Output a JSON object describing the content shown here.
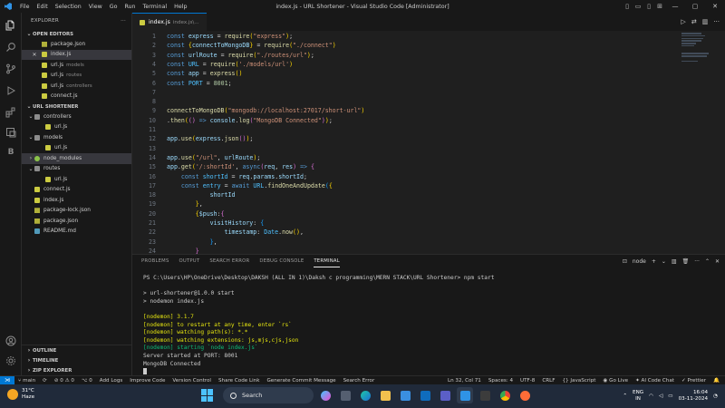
{
  "window": {
    "title": "index.js - URL Shortener - Visual Studio Code [Administrator]",
    "menu": [
      "File",
      "Edit",
      "Selection",
      "View",
      "Go",
      "Run",
      "Terminal",
      "Help"
    ]
  },
  "sidebar": {
    "header": "EXPLORER",
    "open_editors_label": "OPEN EDITORS",
    "open_editors": [
      {
        "name": "package.json",
        "desc": "",
        "icon": "json"
      },
      {
        "name": "index.js",
        "desc": "",
        "icon": "js",
        "active": true
      },
      {
        "name": "url.js",
        "desc": "models",
        "icon": "js"
      },
      {
        "name": "url.js",
        "desc": "routes",
        "icon": "js"
      },
      {
        "name": "url.js",
        "desc": "controllers",
        "icon": "js"
      },
      {
        "name": "connect.js",
        "desc": "",
        "icon": "js"
      }
    ],
    "project_label": "URL SHORTENER",
    "tree": [
      {
        "name": "controllers",
        "type": "folder",
        "depth": 1
      },
      {
        "name": "url.js",
        "type": "js",
        "depth": 2
      },
      {
        "name": "models",
        "type": "folder",
        "depth": 1
      },
      {
        "name": "url.js",
        "type": "js",
        "depth": 2
      },
      {
        "name": "node_modules",
        "type": "nm",
        "depth": 1
      },
      {
        "name": "routes",
        "type": "folder",
        "depth": 1
      },
      {
        "name": "url.js",
        "type": "js",
        "depth": 2
      },
      {
        "name": "connect.js",
        "type": "js",
        "depth": 1
      },
      {
        "name": "index.js",
        "type": "js",
        "depth": 1
      },
      {
        "name": "package-lock.json",
        "type": "json",
        "depth": 1
      },
      {
        "name": "package.json",
        "type": "json",
        "depth": 1
      },
      {
        "name": "README.md",
        "type": "md",
        "depth": 1
      }
    ],
    "outline_label": "OUTLINE",
    "timeline_label": "TIMELINE",
    "zip_label": "ZIP EXPLORER"
  },
  "editor": {
    "tab_name": "index.js",
    "tab_path": "index.js\\...",
    "lines": [
      {
        "n": "1",
        "html": "<span class='k'>const</span> <span class='v'>express</span> <span class='p'>=</span> <span class='f'>require</span><span class='b1'>(</span><span class='s'>\"express\"</span><span class='b1'>)</span><span class='p'>;</span>"
      },
      {
        "n": "2",
        "html": "<span class='k'>const</span> <span class='b1'>{</span><span class='v'>connectToMongoDB</span><span class='b1'>}</span> <span class='p'>=</span> <span class='f'>require</span><span class='b1'>(</span><span class='s'>\"./connect\"</span><span class='b1'>)</span>"
      },
      {
        "n": "3",
        "html": "<span class='k'>const</span> <span class='v'>urlRoute</span> <span class='p'>=</span> <span class='f'>require</span><span class='b1'>(</span><span class='s'>\"./routes/url\"</span><span class='b1'>)</span><span class='p'>;</span>"
      },
      {
        "n": "4",
        "html": "<span class='k'>const</span> <span class='c2'>URL</span> <span class='p'>=</span> <span class='f'>require</span><span class='b1'>(</span><span class='s'>'./models/url'</span><span class='b1'>)</span>"
      },
      {
        "n": "5",
        "html": "<span class='k'>const</span> <span class='v'>app</span> <span class='p'>=</span> <span class='f'>express</span><span class='b1'>()</span>"
      },
      {
        "n": "6",
        "html": "<span class='k'>const</span> <span class='c2'>PORT</span> <span class='p'>=</span> <span class='n'>8001</span><span class='p'>;</span>"
      },
      {
        "n": "7",
        "html": ""
      },
      {
        "n": "8",
        "html": ""
      },
      {
        "n": "9",
        "html": "<span class='f'>connectToMongoDB</span><span class='b1'>(</span><span class='s'>\"mongodb://localhost:27017/short-url\"</span><span class='b1'>)</span>"
      },
      {
        "n": "10",
        "html": "<span class='p'>.</span><span class='f'>then</span><span class='b1'>(</span><span class='b2'>()</span> <span class='k'>=&gt;</span> <span class='v'>console</span><span class='p'>.</span><span class='f'>log</span><span class='b2'>(</span><span class='s'>\"MongoDB Connected\"</span><span class='b2'>)</span><span class='b1'>)</span><span class='p'>;</span>"
      },
      {
        "n": "11",
        "html": ""
      },
      {
        "n": "12",
        "html": "<span class='v'>app</span><span class='p'>.</span><span class='f'>use</span><span class='b1'>(</span><span class='v'>express</span><span class='p'>.</span><span class='f'>json</span><span class='b2'>()</span><span class='b1'>)</span><span class='p'>;</span>"
      },
      {
        "n": "13",
        "html": ""
      },
      {
        "n": "14",
        "html": "<span class='v'>app</span><span class='p'>.</span><span class='f'>use</span><span class='b1'>(</span><span class='s'>\"/url\"</span><span class='p'>,</span> <span class='v'>urlRoute</span><span class='b1'>)</span><span class='p'>;</span>"
      },
      {
        "n": "15",
        "html": "<span class='v'>app</span><span class='p'>.</span><span class='f'>get</span><span class='b1'>(</span><span class='s'>'/:shortId'</span><span class='p'>,</span> <span class='k'>async</span><span class='b2'>(</span><span class='v'>req</span><span class='p'>,</span> <span class='v'>res</span><span class='b2'>)</span> <span class='k'>=&gt;</span> <span class='b2'>{</span>"
      },
      {
        "n": "16",
        "html": "    <span class='k'>const</span> <span class='c2'>shortId</span> <span class='p'>=</span> <span class='v'>req</span><span class='p'>.</span><span class='v'>params</span><span class='p'>.</span><span class='v'>shortId</span><span class='p'>;</span>"
      },
      {
        "n": "17",
        "html": "    <span class='k'>const</span> <span class='c2'>entry</span> <span class='p'>=</span> <span class='k'>await</span> <span class='c2'>URL</span><span class='p'>.</span><span class='f'>findOneAndUpdate</span><span class='b3'>(</span><span class='b1'>{</span>"
      },
      {
        "n": "18",
        "html": "            <span class='v'>shortId</span>"
      },
      {
        "n": "19",
        "html": "        <span class='b1'>}</span><span class='p'>,</span>"
      },
      {
        "n": "20",
        "html": "        <span class='b1'>{</span><span class='v'>$push</span><span class='p'>:</span><span class='b2'>{</span>"
      },
      {
        "n": "21",
        "html": "            <span class='v'>visitHistory</span><span class='p'>:</span> <span class='b3'>{</span>"
      },
      {
        "n": "22",
        "html": "                <span class='v'>timestamp</span><span class='p'>:</span> <span class='c2'>Date</span><span class='p'>.</span><span class='f'>now</span><span class='b1'>()</span><span class='p'>,</span>"
      },
      {
        "n": "23",
        "html": "            <span class='b3'>}</span><span class='p'>,</span>"
      },
      {
        "n": "24",
        "html": "        <span class='b2'>}</span>"
      }
    ]
  },
  "panel": {
    "tabs": [
      "PROBLEMS",
      "OUTPUT",
      "SEARCH ERROR",
      "DEBUG CONSOLE",
      "TERMINAL"
    ],
    "active_tab": "TERMINAL",
    "terminal_name": "node",
    "terminal_lines": [
      {
        "t": "PS C:\\Users\\HP\\OneDrive\\Desktop\\DAKSH (ALL IN 1)\\Daksh c programming\\MERN STACK\\URL Shortener> npm start",
        "c": ""
      },
      {
        "t": "",
        "c": ""
      },
      {
        "t": "> url-shortener@1.0.0 start",
        "c": ""
      },
      {
        "t": "> nodemon index.js",
        "c": ""
      },
      {
        "t": "",
        "c": ""
      },
      {
        "t": "[nodemon] 3.1.7",
        "c": "ty"
      },
      {
        "t": "[nodemon] to restart at any time, enter `rs`",
        "c": "ty"
      },
      {
        "t": "[nodemon] watching path(s): *.*",
        "c": "ty"
      },
      {
        "t": "[nodemon] watching extensions: js,mjs,cjs,json",
        "c": "ty"
      },
      {
        "t": "[nodemon] starting `node index.js`",
        "c": "tg"
      },
      {
        "t": "Server started at PORT: 8001",
        "c": ""
      },
      {
        "t": "MongoDB Connected",
        "c": ""
      }
    ]
  },
  "statusbar": {
    "branch": "main",
    "sync": "⟳",
    "problems": "⊘ 0  ⚠ 0",
    "ports": "⌥ 0",
    "items_left": [
      "Add Logs",
      "Improve Code",
      "Version Control",
      "Share Code Link",
      "Generate Commit Message",
      "Search Error"
    ],
    "position": "Ln 32, Col 71",
    "spaces": "Spaces: 4",
    "encoding": "UTF-8",
    "eol": "CRLF",
    "language": "{} JavaScript",
    "golive": "Go Live",
    "ai": "AI Code Chat",
    "prettier": "Prettier"
  },
  "taskbar": {
    "temp": "31°C",
    "weather": "Haze",
    "search_placeholder": "Search",
    "lang_top": "ENG",
    "lang_bottom": "IN",
    "time": "16:04",
    "date": "03-11-2024"
  },
  "colors": {
    "accent": "#0078d4",
    "editor_bg": "#1f1f1f",
    "sidebar_bg": "#181818"
  }
}
